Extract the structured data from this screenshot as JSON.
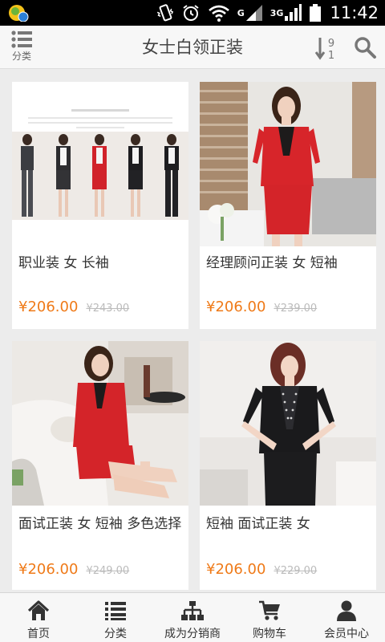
{
  "status_bar": {
    "net_g": "G",
    "net_3g": "3G",
    "time": "11:42"
  },
  "header": {
    "category_label": "分类",
    "title": "女士白领正装",
    "sort_icon": "sort-9-1-icon",
    "search_icon": "search-icon"
  },
  "products": [
    {
      "name": "职业装 女 长袖",
      "price": "¥206.00",
      "original_price": "¥243.00",
      "image_subject": "six-women-black-white-red-suits-collage"
    },
    {
      "name": "经理顾问正装 女 短袖",
      "price": "¥206.00",
      "original_price": "¥239.00",
      "image_subject": "woman-red-short-sleeve-suit-office"
    },
    {
      "name": "面试正装 女 短袖 多色选择",
      "price": "¥206.00",
      "original_price": "¥249.00",
      "image_subject": "woman-red-suit-seated-sofa"
    },
    {
      "name": "短袖 面试正装 女",
      "price": "¥206.00",
      "original_price": "¥229.00",
      "image_subject": "woman-black-short-sleeve-suit"
    }
  ],
  "bottom_nav": [
    {
      "label": "首页",
      "icon": "home-icon"
    },
    {
      "label": "分类",
      "icon": "list-icon"
    },
    {
      "label": "成为分销商",
      "icon": "sitemap-icon"
    },
    {
      "label": "购物车",
      "icon": "cart-icon"
    },
    {
      "label": "会员中心",
      "icon": "user-icon"
    }
  ],
  "colors": {
    "price": "#ef7a18",
    "original_price": "#bbbbbb",
    "status_bar": "#000000",
    "header_bg": "#f7f7f7",
    "page_bg": "#ececec"
  }
}
